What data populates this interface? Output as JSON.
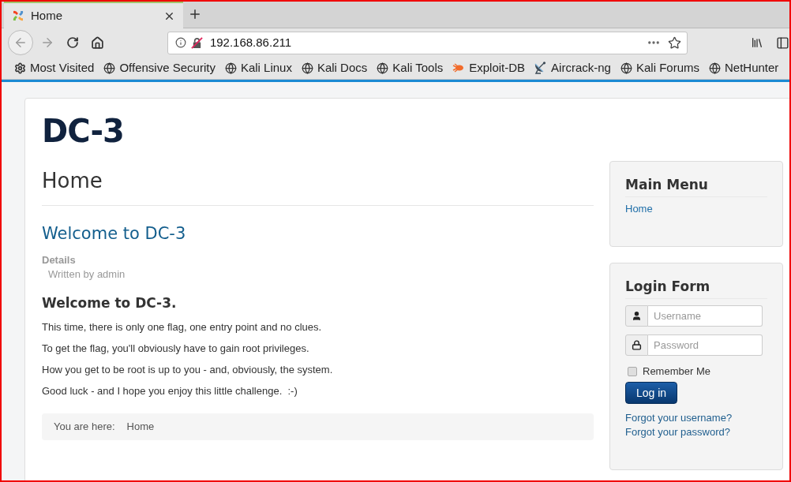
{
  "browser": {
    "tabs": [
      {
        "title": "Home",
        "selected": true
      }
    ],
    "address": "192.168.86.211",
    "bookmarks": [
      {
        "label": "Most Visited",
        "kind": "folder"
      },
      {
        "label": "Offensive Security",
        "kind": "site"
      },
      {
        "label": "Kali Linux",
        "kind": "site"
      },
      {
        "label": "Kali Docs",
        "kind": "site"
      },
      {
        "label": "Kali Tools",
        "kind": "site"
      },
      {
        "label": "Exploit-DB",
        "kind": "bug"
      },
      {
        "label": "Aircrack-ng",
        "kind": "dish"
      },
      {
        "label": "Kali Forums",
        "kind": "site"
      },
      {
        "label": "NetHunter",
        "kind": "site"
      }
    ]
  },
  "page": {
    "site_title": "DC-3",
    "page_heading": "Home",
    "article": {
      "title": "Welcome to DC-3",
      "details_label": "Details",
      "author": "Written by admin",
      "heading": "Welcome to DC-3.",
      "paragraphs": [
        "This time, there is only one flag, one entry point and no clues.",
        "To get the flag, you'll obviously have to gain root privileges.",
        "How you get to be root is up to you - and, obviously, the system.",
        "Good luck - and I hope you enjoy this little challenge.  :-)"
      ]
    },
    "breadcrumb": {
      "label": "You are here:",
      "items": [
        "Home"
      ]
    }
  },
  "sidebar": {
    "main_menu": {
      "title": "Main Menu",
      "items": [
        "Home"
      ]
    },
    "login_form": {
      "title": "Login Form",
      "username": {
        "placeholder": "Username"
      },
      "password": {
        "placeholder": "Password"
      },
      "remember": {
        "label": "Remember Me",
        "checked": false
      },
      "submit": "Log in",
      "links": [
        "Forgot your username?",
        "Forgot your password?"
      ]
    }
  }
}
